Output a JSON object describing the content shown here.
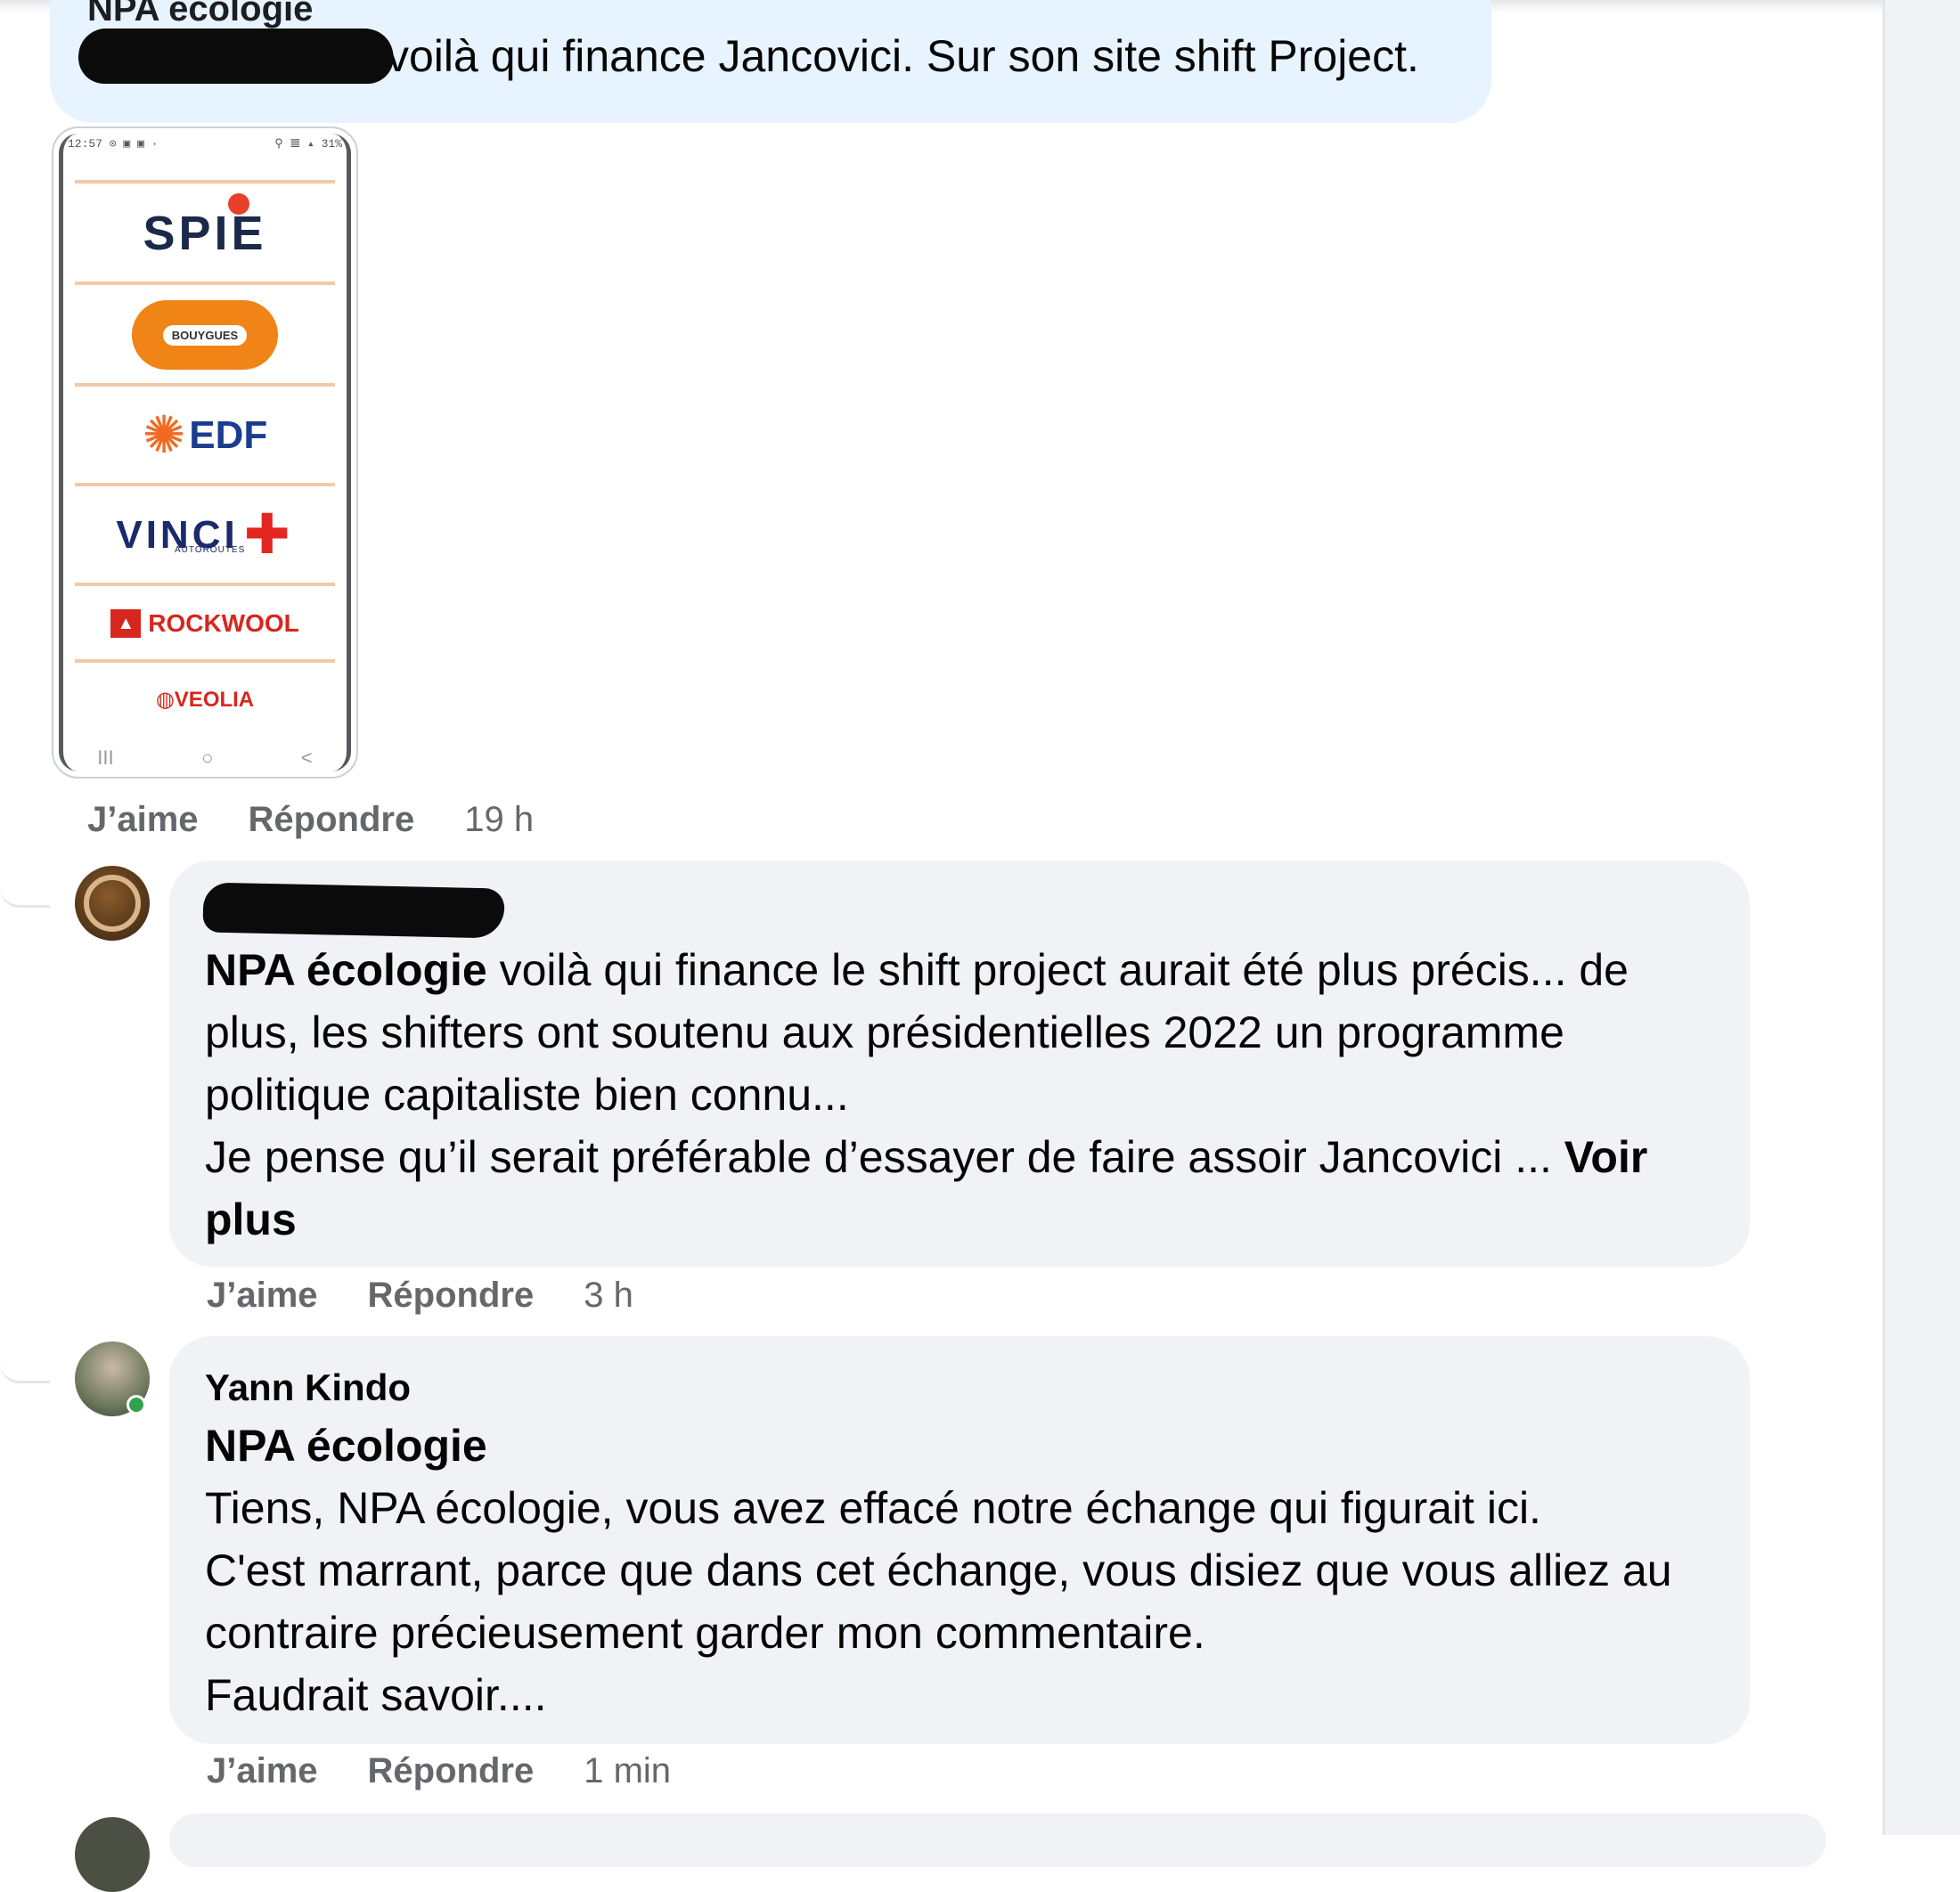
{
  "top_comment": {
    "author": "NPA écologie",
    "text": "voilà qui finance Jancovici. Sur son site shift Project.",
    "actions": {
      "like": "J’aime",
      "reply": "Répondre",
      "time": "19 h"
    }
  },
  "phone_image": {
    "status_left": "12:57 ⊙ ▣ ▣ ·",
    "status_right": "⚲ 𝌆 ▴ 31%",
    "logos": [
      "SPIE",
      "BOUYGUES",
      "EDF",
      "VINCI",
      "AUTOROUTES",
      "ROCKWOOL",
      "VEOLIA"
    ],
    "nav": [
      "III",
      "○",
      "<"
    ]
  },
  "comment_1": {
    "mention": "NPA écologie",
    "line1": " voilà qui finance le shift project aurait été plus précis... de",
    "line2": "plus, les shifters ont soutenu aux présidentielles 2022 un programme",
    "line3": "politique capitaliste bien connu...",
    "line4": "Je pense qu’il serait préférable d’essayer de faire assoir Jancovici ... ",
    "see_more_a": "Voir",
    "see_more_b": "plus",
    "actions": {
      "like": "J’aime",
      "reply": "Répondre",
      "time": "3 h"
    }
  },
  "comment_2": {
    "author": "Yann Kindo",
    "mention": "NPA écologie",
    "line1": "Tiens, NPA écologie, vous avez effacé notre échange qui figurait ici.",
    "line2": "C'est marrant, parce que dans cet échange, vous disiez que vous alliez au",
    "line3": "contraire précieusement garder mon commentaire.",
    "line4": "Faudrait savoir....",
    "actions": {
      "like": "J’aime",
      "reply": "Répondre",
      "time": "1 min"
    }
  },
  "colors": {
    "bubble_own": "#e7f3ff",
    "bubble": "#f0f2f5",
    "meta_text": "#65676b",
    "online": "#31a24c"
  }
}
